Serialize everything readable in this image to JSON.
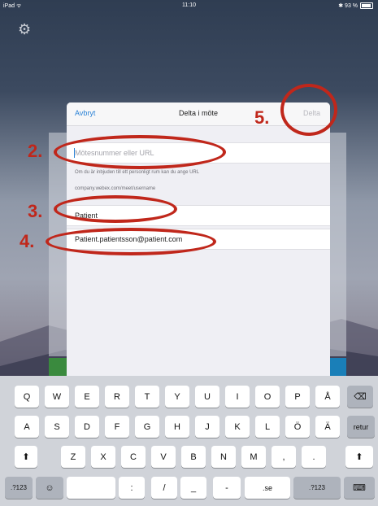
{
  "status_bar": {
    "left": "iPad ᯤ",
    "time": "11:10",
    "right": "✱ 93 %"
  },
  "modal": {
    "cancel_label": "Avbryt",
    "title": "Delta i möte",
    "join_label": "Delta",
    "meeting_field": {
      "placeholder": "Mötesnummer eller URL",
      "value": ""
    },
    "hint_line1": "Om du är inbjuden till ett personligt rum kan du ange URL",
    "hint_line2": "company.webex.com/meet/username",
    "name_field": {
      "value": "Patient"
    },
    "email_field": {
      "value": "Patient.patientsson@patient.com"
    }
  },
  "annotations": {
    "n2": "2.",
    "n3": "3.",
    "n4": "4.",
    "n5": "5."
  },
  "keyboard": {
    "row1": [
      "Q",
      "W",
      "E",
      "R",
      "T",
      "Y",
      "U",
      "I",
      "O",
      "P",
      "Å"
    ],
    "row2": [
      "A",
      "S",
      "D",
      "F",
      "G",
      "H",
      "J",
      "K",
      "L",
      "Ö",
      "Ä"
    ],
    "return_label": "retur",
    "row3": [
      "Z",
      "X",
      "C",
      "V",
      "B",
      "N",
      "M",
      ",",
      "."
    ],
    "num_label": ".?123",
    "emoji": "☺",
    "row4_mid": [
      ":",
      "/",
      "_",
      "-"
    ],
    "se_label": ".se",
    "num_label_right": ".?123",
    "backspace_icon": "⌫",
    "shift_icon": "⬆",
    "hide_kb_icon": "⌨"
  },
  "colors": {
    "accent": "#2a82d6",
    "annotation": "#c0271b"
  }
}
